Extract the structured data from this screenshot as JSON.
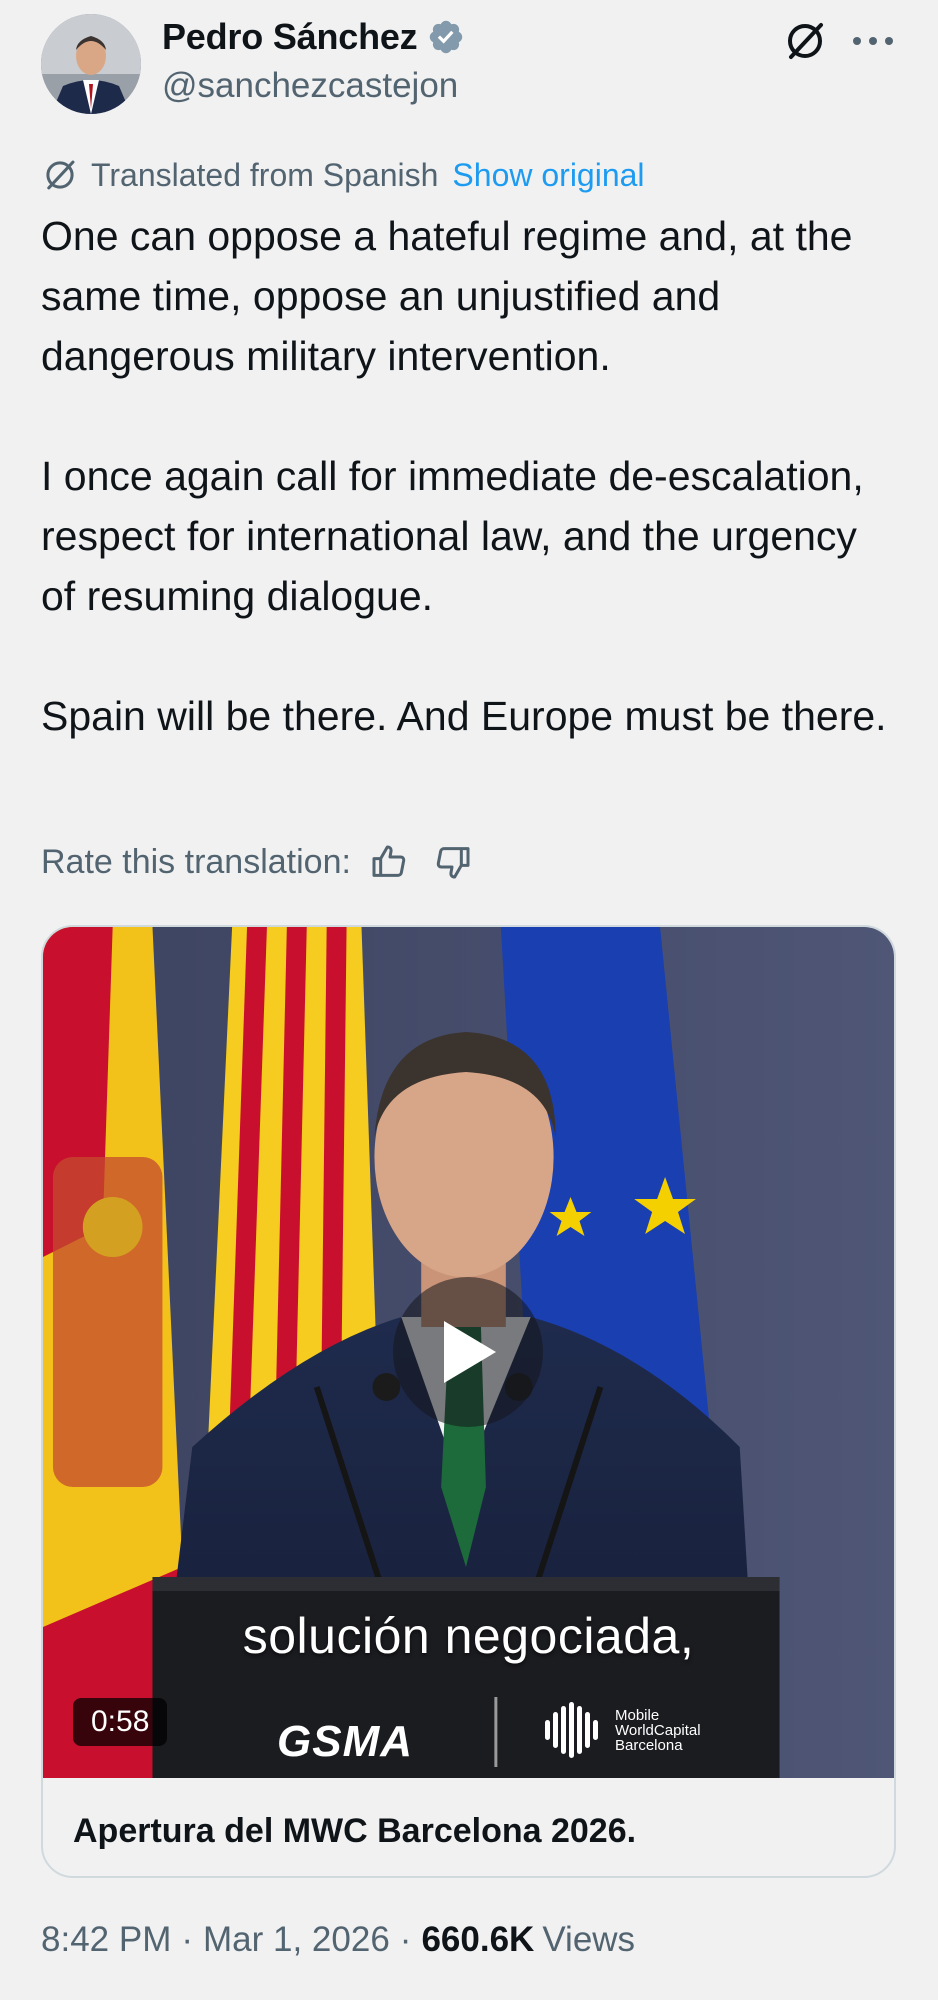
{
  "author": {
    "display_name": "Pedro Sánchez",
    "handle": "@sanchezcastejon",
    "verified": true
  },
  "header": {
    "grok_icon": "grok-icon",
    "more_icon": "more-icon"
  },
  "translation": {
    "label": "Translated from Spanish",
    "show_original": "Show original"
  },
  "tweet": {
    "paragraphs": [
      "One can oppose a hateful regime and, at the same time, oppose an unjustified and dangerous military intervention.",
      "I once again call for immediate de-escalation, respect for international law, and the urgency of resuming dialogue.",
      "Spain will be there. And Europe must be there."
    ]
  },
  "rate": {
    "label": "Rate this translation:"
  },
  "media": {
    "subtitle": "solución negociada,",
    "gsma": "GSMA",
    "mwc_line1": "Mobile",
    "mwc_line2": "WorldCapital",
    "mwc_line3": "Barcelona",
    "duration": "0:58",
    "title": "Apertura del MWC Barcelona 2026."
  },
  "meta": {
    "time": "8:42 PM",
    "date": "Mar 1, 2026",
    "views_count": "660.6K",
    "views_label": "Views"
  },
  "colors": {
    "background": "#f1f1f2",
    "link": "#1d9bf0",
    "secondary_text": "#536471",
    "verified": "#829aab"
  }
}
